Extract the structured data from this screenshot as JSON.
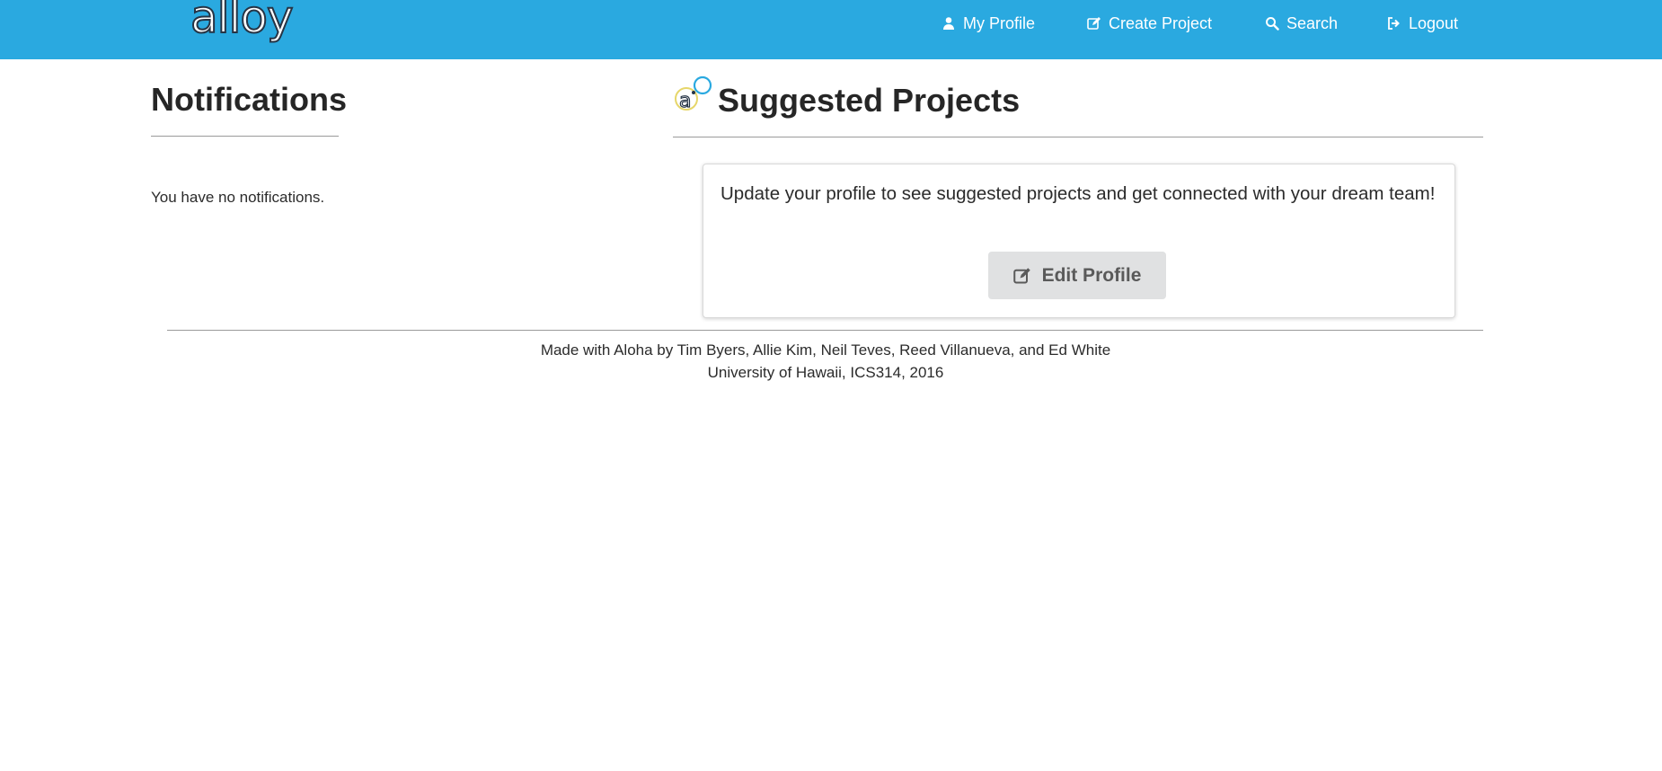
{
  "nav": {
    "logo_text": "alloy",
    "items": [
      {
        "label": "My Profile",
        "icon": "user-icon"
      },
      {
        "label": "Create Project",
        "icon": "edit-icon"
      },
      {
        "label": "Search",
        "icon": "search-icon"
      },
      {
        "label": "Logout",
        "icon": "logout-icon"
      }
    ]
  },
  "notifications": {
    "title": "Notifications",
    "empty_text": "You have no notifications."
  },
  "suggested": {
    "title": "Suggested Projects",
    "message": "Update your profile to see suggested projects and get connected with your dream team!",
    "button_label": "Edit Profile",
    "button_icon": "edit-icon"
  },
  "footer": {
    "line1": "Made with Aloha by Tim Byers, Allie Kim, Neil Teves, Reed Villanueva, and Ed White",
    "line2": "University of Hawaii, ICS314, 2016"
  },
  "colors": {
    "navbar": "#2aa9e0",
    "button_bg": "#e0e1e2"
  }
}
